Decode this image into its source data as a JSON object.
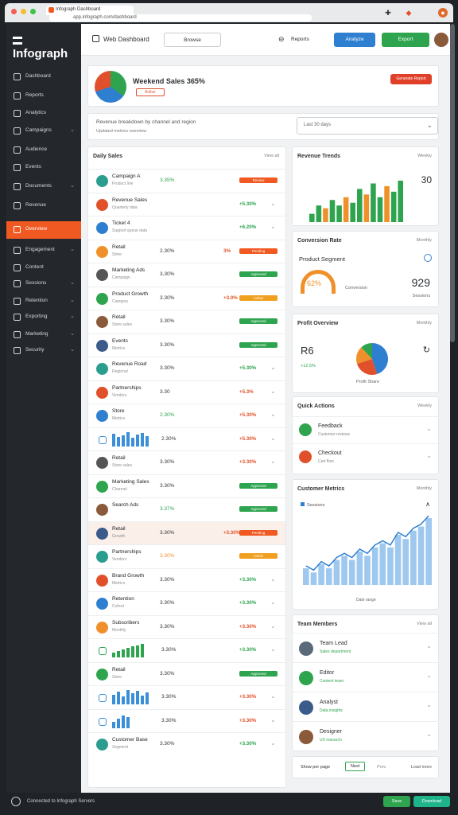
{
  "browser": {
    "tab_title": "Infograph Dashboard",
    "address": "app.infograph.com/dashboard"
  },
  "brand": {
    "name": "Infograph"
  },
  "sidebar": {
    "items": [
      {
        "label": "Dashboard",
        "chev": ""
      },
      {
        "label": "Reports",
        "chev": ""
      },
      {
        "label": "Analytics",
        "chev": ""
      },
      {
        "label": "Campaigns",
        "chev": "⌄"
      },
      {
        "label": "Audience",
        "chev": ""
      },
      {
        "label": "Events",
        "chev": ""
      },
      {
        "label": "Documents",
        "chev": "⌄"
      },
      {
        "label": "Revenue",
        "chev": ""
      },
      {
        "label": "Overview",
        "chev": ""
      },
      {
        "label": "Engagement",
        "chev": "⌄"
      },
      {
        "label": "Content",
        "chev": ""
      },
      {
        "label": "Sessions",
        "chev": "⌄"
      },
      {
        "label": "Retention",
        "chev": "⌄"
      },
      {
        "label": "Exporting",
        "chev": "⌄"
      },
      {
        "label": "Marketing",
        "chev": "⌄"
      },
      {
        "label": "Security",
        "chev": "⌄"
      }
    ]
  },
  "topbar": {
    "title": "Web Dashboard",
    "search_label": "Browse",
    "filter_label": "Reports",
    "primary_label": "Analyze",
    "secondary_label": "Export"
  },
  "hero": {
    "title": "Weekend Sales 365%",
    "tag": "Active",
    "action_label": "Generate Report"
  },
  "filterbar": {
    "line1": "Revenue breakdown by channel and region",
    "line2": "Updated metrics overview",
    "select_label": "Last 30 days"
  },
  "list": {
    "title": "Daily Sales",
    "more_label": "View all",
    "rows": [
      {
        "name": "Campaign A",
        "sub": "Product line",
        "value": "3.35%",
        "vclass": "g",
        "pill": "Review",
        "pcolor": "#f05a22"
      },
      {
        "name": "Revenue Sales",
        "sub": "Quarterly data",
        "value": "",
        "vclass": "",
        "pill": "",
        "pcolor": "",
        "pct": "+5.30%",
        "pctclass": "g"
      },
      {
        "name": "Ticket 4",
        "sub": "Support queue data",
        "value": "",
        "vclass": "",
        "pill": "",
        "pcolor": "",
        "pct": "+6.20%",
        "pctclass": "g"
      },
      {
        "name": "Retail",
        "sub": "Store",
        "value": "2.30%",
        "vclass": "",
        "pill": "Pending",
        "pcolor": "#f05a22",
        "pct": "3%",
        "pctclass": "r"
      },
      {
        "name": "Marketing Ads",
        "sub": "Campaign",
        "value": "3.30%",
        "vclass": "",
        "pill": "Approved",
        "pcolor": "#2ea44f"
      },
      {
        "name": "Product Growth",
        "sub": "Category",
        "value": "3.30%",
        "vclass": "",
        "pill": "Active",
        "pcolor": "#f0a020",
        "pct": "+3.0%",
        "pctclass": "r"
      },
      {
        "name": "Retail",
        "sub": "Store sales",
        "value": "3.30%",
        "vclass": "",
        "pill": "Approved",
        "pcolor": "#2ea44f"
      },
      {
        "name": "Events",
        "sub": "Metrics",
        "value": "3.30%",
        "vclass": "",
        "pill": "Approved",
        "pcolor": "#2ea44f"
      },
      {
        "name": "Revenue Road",
        "sub": "Regional",
        "value": "3.30%",
        "vclass": "",
        "pill": "",
        "pcolor": "",
        "pct": "+5.30%",
        "pctclass": "g"
      },
      {
        "name": "Partnerships",
        "sub": "Vendors",
        "value": "3.30",
        "vclass": "",
        "pill": "",
        "pcolor": "",
        "pct": "+5.3%",
        "pctclass": "r"
      },
      {
        "name": "Store",
        "sub": "Metrics",
        "value": "2.30%",
        "vclass": "g",
        "pill": "",
        "pcolor": "",
        "pct": "+5.30%",
        "pctclass": "r"
      },
      {
        "name": "",
        "sub": "",
        "value": "2.30%",
        "vclass": "",
        "pill": "",
        "pcolor": "",
        "pct": "+5.30%",
        "pctclass": "r",
        "spark": [
          16,
          12,
          14,
          18,
          11,
          15,
          17,
          13
        ],
        "scolor": "#3b8fd8"
      },
      {
        "name": "Retail",
        "sub": "Store sales",
        "value": "3.30%",
        "vclass": "",
        "pill": "",
        "pcolor": "",
        "pct": "+3.30%",
        "pctclass": "r"
      },
      {
        "name": "Marketing Sales",
        "sub": "Channel",
        "value": "3.30%",
        "vclass": "",
        "pill": "Approved",
        "pcolor": "#2ea44f"
      },
      {
        "name": "Search Ads",
        "sub": "",
        "value": "3.37%",
        "vclass": "g",
        "pill": "Approved",
        "pcolor": "#2ea44f"
      },
      {
        "name": "Retail",
        "sub": "Growth",
        "value": "3.30%",
        "vclass": "",
        "pill": "Pending",
        "pcolor": "#f05a22",
        "pct": "+3.30%",
        "pctclass": "r"
      },
      {
        "name": "Partnerships",
        "sub": "Vendors",
        "value": "3.30%",
        "vclass": "o",
        "pill": "Active",
        "pcolor": "#f0a020"
      },
      {
        "name": "Brand Growth",
        "sub": "Metrics",
        "value": "3.30%",
        "vclass": "",
        "pill": "",
        "pcolor": "",
        "pct": "+3.30%",
        "pctclass": "g"
      },
      {
        "name": "Retention",
        "sub": "Cohort",
        "value": "3.30%",
        "vclass": "",
        "pill": "",
        "pcolor": "",
        "pct": "+3.30%",
        "pctclass": "g"
      },
      {
        "name": "Subscribers",
        "sub": "Monthly",
        "value": "3.30%",
        "vclass": "",
        "pill": "",
        "pcolor": "",
        "pct": "+3.30%",
        "pctclass": "r"
      },
      {
        "name": "",
        "sub": "",
        "value": "3.30%",
        "vclass": "",
        "pill": "",
        "pcolor": "",
        "pct": "+3.30%",
        "pctclass": "g",
        "spark": [
          6,
          8,
          10,
          12,
          14,
          15,
          17
        ],
        "scolor": "#2ea44f"
      },
      {
        "name": "Retail",
        "sub": "Store",
        "value": "3.30%",
        "vclass": "",
        "pill": "Approved",
        "pcolor": "#2ea44f"
      },
      {
        "name": "",
        "sub": "",
        "value": "3.30%",
        "vclass": "",
        "pill": "",
        "pcolor": "",
        "pct": "+3.30%",
        "pctclass": "r",
        "spark": [
          12,
          16,
          10,
          18,
          14,
          17,
          11,
          15
        ],
        "scolor": "#3b8fd8"
      },
      {
        "name": "",
        "sub": "",
        "value": "3.30%",
        "vclass": "",
        "pill": "",
        "pcolor": "",
        "pct": "+3.30%",
        "pctclass": "r",
        "spark": [
          8,
          12,
          16,
          14
        ],
        "scolor": "#3b8fd8"
      },
      {
        "name": "Customer Base",
        "sub": "Segment",
        "value": "3.30%",
        "vclass": "",
        "pill": "",
        "pcolor": "",
        "pct": "+3.30%",
        "pctclass": "g"
      }
    ]
  },
  "panels": {
    "rev_title": "Revenue Trends",
    "rev_more": "Weekly",
    "rev_value": "30",
    "rev_chart": {
      "type": "bar",
      "values": [
        3,
        6,
        5,
        8,
        6,
        9,
        7,
        12,
        10,
        14,
        9,
        13,
        11,
        15
      ]
    },
    "conv_title": "Conversion Rate",
    "conv_more": "Monthly",
    "conv_sub": "Product Segment",
    "conv_gauge": "62%",
    "conv_gauge_label": "Conversion",
    "conv_value": "929",
    "conv_value_label": "Sessions",
    "pie_title": "Profit Overview",
    "pie_more": "Monthly",
    "pie_value": "R6",
    "pie_sub": "+12.5%",
    "pie_label": "Profit Share",
    "pie_data": [
      {
        "v": 45,
        "c": "#2f7fd0"
      },
      {
        "v": 25,
        "c": "#e0502a"
      },
      {
        "v": 18,
        "c": "#f0902a"
      },
      {
        "v": 12,
        "c": "#2ea44f"
      }
    ],
    "task_title": "Quick Actions",
    "task_more": "Weekly",
    "task_items": [
      {
        "title": "Feedback",
        "sub": "Customer reviews"
      },
      {
        "title": "Checkout",
        "sub": "Cart flow"
      }
    ],
    "line_title": "Customer Metrics",
    "line_more": "Monthly",
    "line_legend": "Sessions",
    "line_xlabel": "Date range",
    "line_chart": {
      "type": "bar",
      "values": [
        4,
        3,
        5,
        4,
        6,
        7,
        6,
        8,
        7,
        9,
        10,
        9,
        12,
        11,
        13,
        14,
        16
      ]
    },
    "team_title": "Team Members",
    "team_more": "View all",
    "team_items": [
      {
        "title": "Team Lead",
        "sub": "Sales department"
      },
      {
        "title": "Editor",
        "sub": "Content team"
      },
      {
        "title": "Analyst",
        "sub": "Data insights"
      },
      {
        "title": "Designer",
        "sub": "UX research"
      }
    ],
    "foot_label": "Show per page",
    "foot_btn": "Next",
    "foot_mid": "Prev",
    "foot_right": "Load more"
  },
  "status": {
    "left": "Connected to Infograph Servers",
    "btn1": "Save",
    "btn2": "Download"
  },
  "colors": {
    "accent": "#f05a22",
    "green": "#2ea44f",
    "blue": "#2f7fd0"
  }
}
